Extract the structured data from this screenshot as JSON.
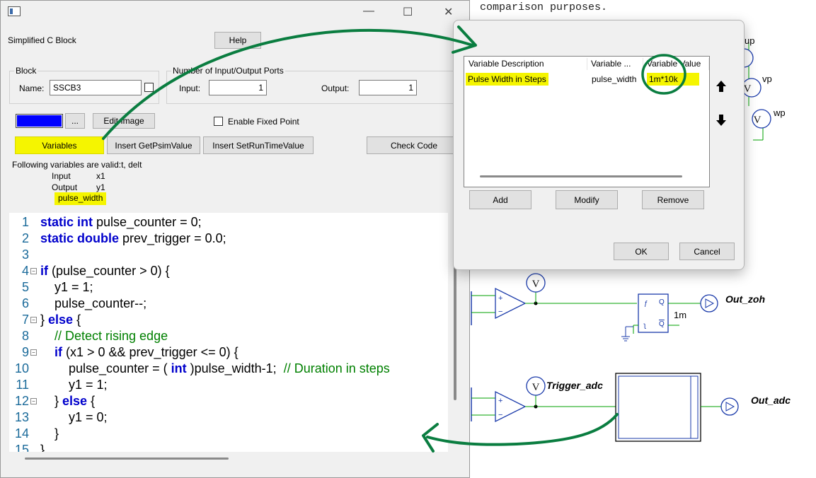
{
  "background": {
    "top_text": "comparison purposes.",
    "probe_labels": {
      "up": "up",
      "vp": "vp",
      "wp": "wp",
      "trigger": "Trigger_adc",
      "v": "V"
    },
    "output_labels": {
      "zoh": "Out_zoh",
      "adc": "Out_adc"
    },
    "zoh_param": "1m",
    "ff_pins": {
      "q": "Q",
      "qbar": "Q"
    }
  },
  "main_dialog": {
    "block_type": "Simplified C Block",
    "help_label": "Help",
    "block_group": {
      "title": "Block",
      "name_label": "Name:",
      "name_value": "SSCB3"
    },
    "ports_group": {
      "title": "Number of Input/Output Ports",
      "input_label": "Input:",
      "input_value": "1",
      "output_label": "Output:",
      "output_value": "1"
    },
    "color_swatch": "#0000ff",
    "ellipsis_label": "...",
    "edit_image_label": "Edit Image",
    "fixed_point_label": "Enable Fixed Point",
    "variables_label": "Variables",
    "get_psim_label": "Insert GetPsimValue",
    "set_runtime_label": "Insert SetRunTimeValue",
    "check_code_label": "Check Code",
    "valid_vars_text": "Following variables are valid:t, delt",
    "input_row": {
      "label": "Input",
      "value": "x1"
    },
    "output_row": {
      "label": "Output",
      "value": "y1"
    },
    "param_var": "pulse_width",
    "code_lines": [
      {
        "n": "1",
        "parts": [
          [
            "kw",
            "static int"
          ],
          [
            "",
            "pulse_counter = 0;"
          ]
        ]
      },
      {
        "n": "2",
        "parts": [
          [
            "kw",
            "static double"
          ],
          [
            "",
            "prev_trigger = 0.0;"
          ]
        ]
      },
      {
        "n": "3",
        "parts": []
      },
      {
        "n": "4",
        "parts": [
          [
            "kw",
            "if"
          ],
          [
            "",
            "(pulse_counter > 0) {"
          ]
        ]
      },
      {
        "n": "5",
        "parts": [
          [
            "",
            "    y1 = 1;"
          ]
        ]
      },
      {
        "n": "6",
        "parts": [
          [
            "",
            "    pulse_counter--;"
          ]
        ]
      },
      {
        "n": "7",
        "parts": [
          [
            "",
            "} "
          ],
          [
            "kw",
            "else"
          ],
          [
            "",
            "{"
          ]
        ]
      },
      {
        "n": "8",
        "parts": [
          [
            "cm",
            "    // Detect rising edge"
          ]
        ]
      },
      {
        "n": "9",
        "parts": [
          [
            "kw",
            "    if"
          ],
          [
            "",
            "(x1 > 0 && prev_trigger <= 0) {"
          ]
        ]
      },
      {
        "n": "10",
        "parts": [
          [
            "",
            "        pulse_counter = ("
          ],
          [
            "kw",
            "int"
          ],
          [
            "",
            ")pulse_width-1;  "
          ],
          [
            "cm",
            "// Duration in steps"
          ]
        ]
      },
      {
        "n": "11",
        "parts": [
          [
            "",
            "        y1 = 1;"
          ]
        ]
      },
      {
        "n": "12",
        "parts": [
          [
            "",
            "    } "
          ],
          [
            "kw",
            "else"
          ],
          [
            "",
            "{"
          ]
        ]
      },
      {
        "n": "13",
        "parts": [
          [
            "",
            "        y1 = 0;"
          ]
        ]
      },
      {
        "n": "14",
        "parts": [
          [
            "",
            "    }"
          ]
        ]
      },
      {
        "n": "15",
        "parts": [
          [
            "",
            "}"
          ]
        ]
      }
    ]
  },
  "variables_dialog": {
    "columns": [
      "Variable Description",
      "Variable ...",
      "Variable Value"
    ],
    "rows": [
      {
        "description": "Pulse Width in Steps",
        "name": "pulse_width",
        "value": "1m*10k"
      }
    ],
    "add_label": "Add",
    "modify_label": "Modify",
    "remove_label": "Remove",
    "ok_label": "OK",
    "cancel_label": "Cancel"
  },
  "colors": {
    "annotation": "#0a7d40",
    "highlight": "#f5f500",
    "wire": "#00a000"
  }
}
